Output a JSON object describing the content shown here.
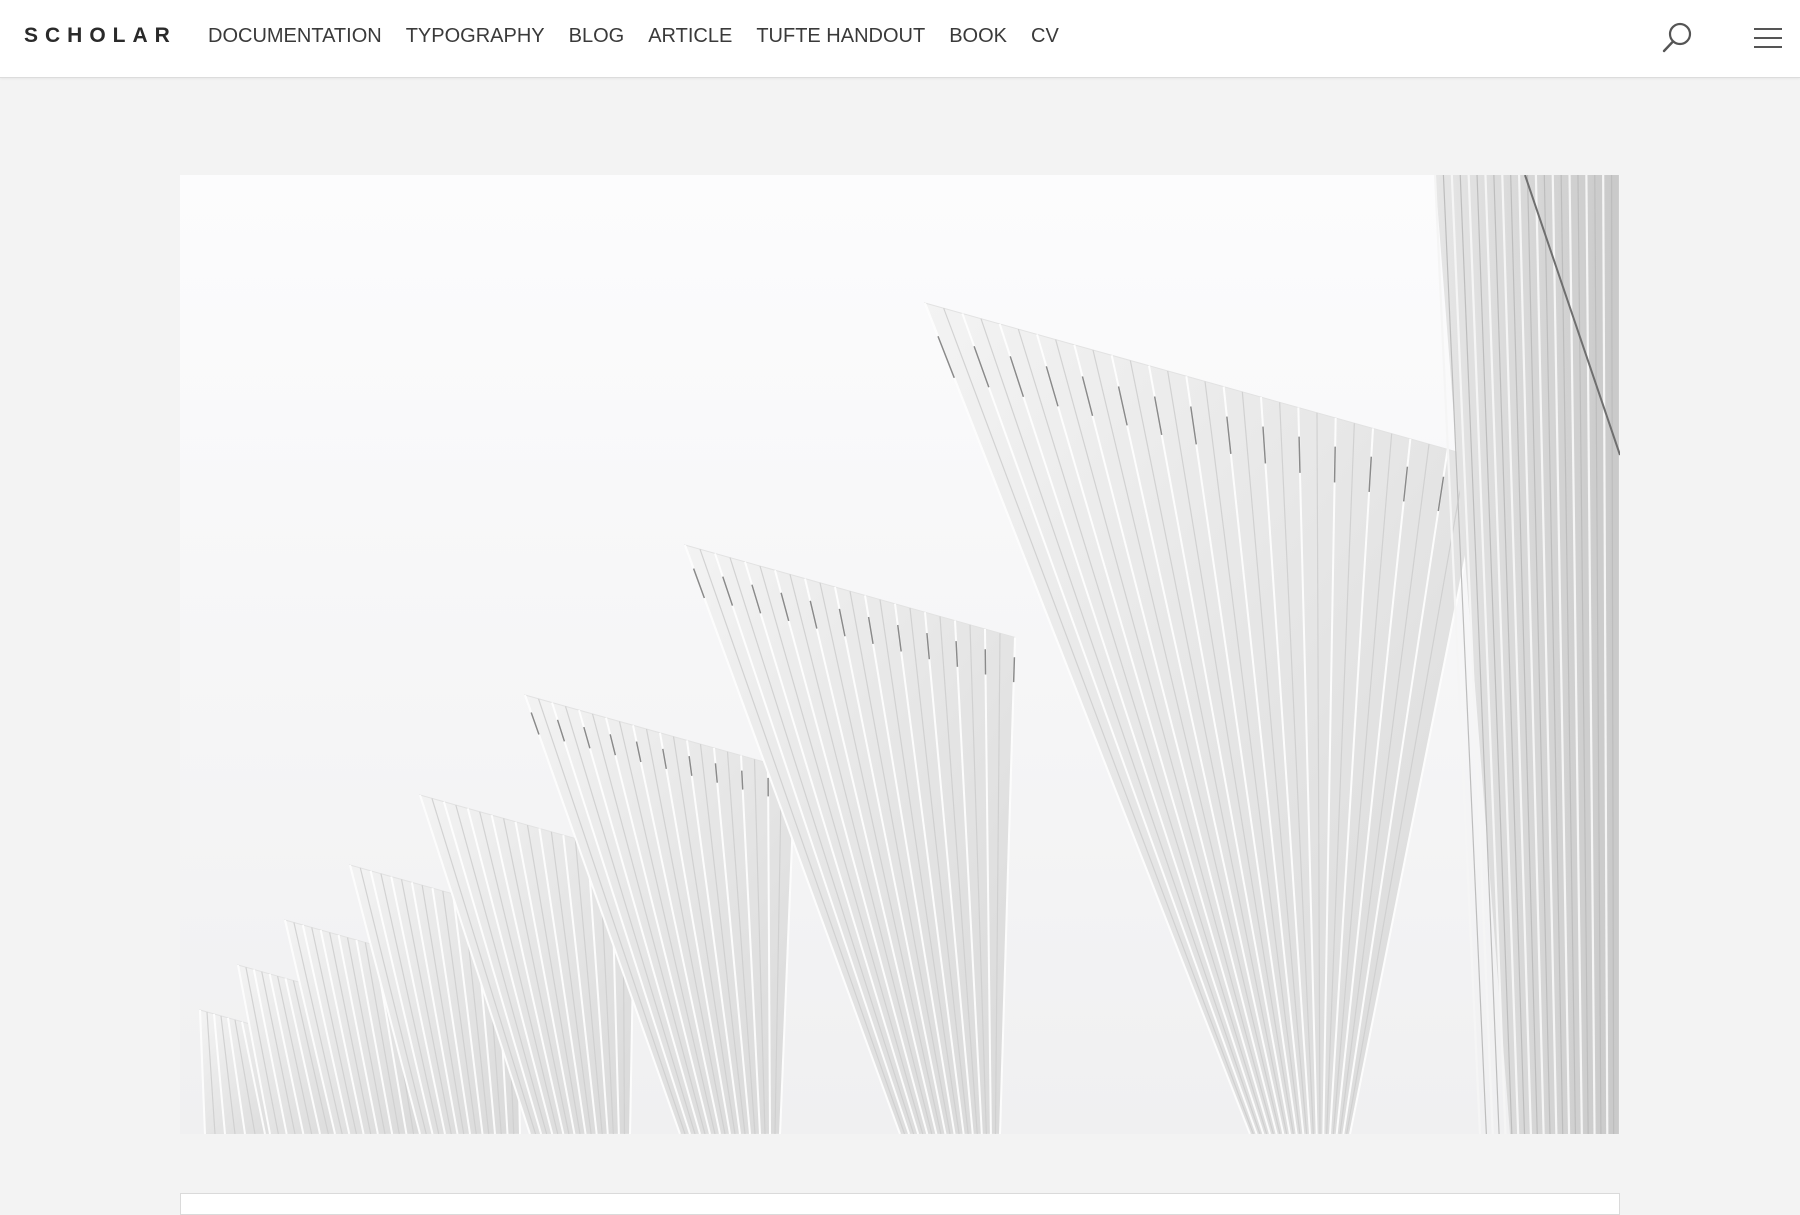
{
  "header": {
    "brand": "SCHOLAR",
    "nav": [
      {
        "label": "DOCUMENTATION"
      },
      {
        "label": "TYPOGRAPHY"
      },
      {
        "label": "BLOG"
      },
      {
        "label": "ARTICLE"
      },
      {
        "label": "TUFTE HANDOUT"
      },
      {
        "label": "BOOK"
      },
      {
        "label": "CV"
      }
    ],
    "search_icon": "search-icon",
    "menu_icon": "hamburger-menu-icon"
  },
  "hero": {
    "subject": "white architectural fan structures",
    "background": "#fafafa"
  },
  "colors": {
    "page_bg": "#f3f3f3",
    "header_bg": "#ffffff",
    "text": "#3a3a3a",
    "brand": "#2a2a2a"
  }
}
